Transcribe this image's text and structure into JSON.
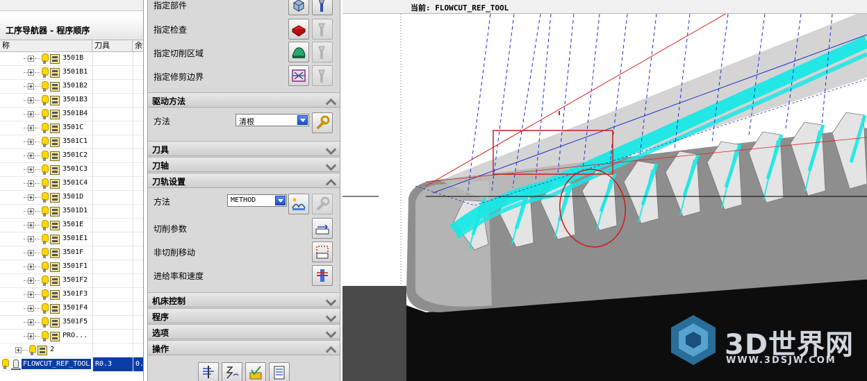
{
  "navigator": {
    "title": "工序导航器 - 程序顺序",
    "columns": {
      "name": "称",
      "tool": "刀具",
      "rest": "余"
    },
    "items": [
      {
        "label": "3501B"
      },
      {
        "label": "3501B1"
      },
      {
        "label": "3501B2"
      },
      {
        "label": "3501B3"
      },
      {
        "label": "3501B4"
      },
      {
        "label": "3501C"
      },
      {
        "label": "3501C1"
      },
      {
        "label": "3501C2"
      },
      {
        "label": "3501C3"
      },
      {
        "label": "3501C4"
      },
      {
        "label": "3501D"
      },
      {
        "label": "3501D1"
      },
      {
        "label": "3501E"
      },
      {
        "label": "3501E1"
      },
      {
        "label": "3501F"
      },
      {
        "label": "3501F1"
      },
      {
        "label": "3501F2"
      },
      {
        "label": "3501F3"
      },
      {
        "label": "3501F4"
      },
      {
        "label": "3501F5"
      },
      {
        "label": "PRO..."
      }
    ],
    "group": {
      "label": "2"
    },
    "selected": {
      "label": "FLOWCUT_REF_TOOL",
      "tool": "R0.3",
      "rest": "0."
    }
  },
  "dialog": {
    "geometry": {
      "part_label": "指定部件",
      "check_label": "指定检查",
      "cut_area_label": "指定切削区域",
      "trim_label": "指定修剪边界"
    },
    "drive": {
      "title": "驱动方法",
      "method_label": "方法",
      "method_value": "清根"
    },
    "tool_section": {
      "title": "刀具"
    },
    "axis_section": {
      "title": "刀轴"
    },
    "path_settings": {
      "title": "刀轨设置",
      "method_label": "方法",
      "method_value": "METHOD",
      "cut_params_label": "切削参数",
      "non_cut_label": "非切削移动",
      "feeds_label": "进给率和速度"
    },
    "machine_section": {
      "title": "机床控制"
    },
    "program_section": {
      "title": "程序"
    },
    "options_section": {
      "title": "选项"
    },
    "actions_section": {
      "title": "操作"
    }
  },
  "graphics": {
    "current_label": "当前: FLOWCUT_REF_TOOL"
  },
  "watermark": {
    "title": "3D世界网",
    "url": "WWW.3DSJW.COM"
  },
  "colors": {
    "toolpath": "#19e8e6",
    "selection": "#0a3ea6",
    "highlight_box": "#d01818",
    "part_gray": "#8e8e8e"
  }
}
